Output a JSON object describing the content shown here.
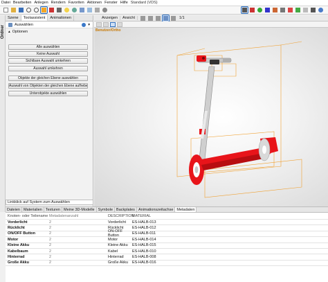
{
  "menu": [
    "Datei",
    "Bearbeiten",
    "Anlegen",
    "Rendern",
    "Favoriten",
    "Aktionen",
    "Fenster",
    "Hilfe",
    "Standard (VDS)"
  ],
  "side_label": "Ordner",
  "left_tabs": [
    "Szene",
    "Toolassistent",
    "Animationen"
  ],
  "panel_title": "Auswählen",
  "section_title": "Optionen",
  "buttons": [
    "Alle auswählen",
    "Keine Auswahl",
    "Sichtbare Auswahl umkehren",
    "Auswahl umkehren",
    "Objekte der gleichen Ebene auswählen",
    "Auswahl von Objekten der gleichen Ebene aufheben",
    "Unterobjekte auswählen"
  ],
  "status_text": "Linkklick auf System zum Auswählen",
  "view_tabs": [
    "Anzeigen",
    "Ansicht"
  ],
  "view_counter": "1/1",
  "view_label": "Benutzer/Ortho",
  "bottom_tabs": [
    "Dateien",
    "Materialien",
    "Texturen",
    "Meine 3D-Modelle",
    "Symbole",
    "Backplates",
    "Animationszeitachse",
    "Metadaten"
  ],
  "table": {
    "headers": [
      "Knoten- oder Teilename",
      "Metadatenanzahl",
      "DESCRIPTION",
      "MATERIAL"
    ],
    "rows": [
      [
        "Vorderlicht",
        "2",
        "Vorderlicht",
        "ES-HALB-013"
      ],
      [
        "Rücklicht",
        "2",
        "Rücklicht",
        "ES-HALB-012"
      ],
      [
        "ON/OFF Button",
        "2",
        "ON-OFF Button",
        "ES-HALB-011"
      ],
      [
        "Motor",
        "2",
        "Motor",
        "ES-HALB-014"
      ],
      [
        "Kleine Akku",
        "2",
        "Kleine Akku",
        "ES-HALB-015"
      ],
      [
        "Kabelbaum",
        "2",
        "Kabel",
        "ES-HALB-010"
      ],
      [
        "Hinterrad",
        "2",
        "Hinterrad",
        "ES-HALB-008"
      ],
      [
        "Große Akku",
        "2",
        "Große Akku",
        "ES-HALB-016"
      ]
    ]
  },
  "colors": {
    "accent": "#2f6fbd",
    "model_red": "#e8141a",
    "selection": "#f0a030"
  }
}
